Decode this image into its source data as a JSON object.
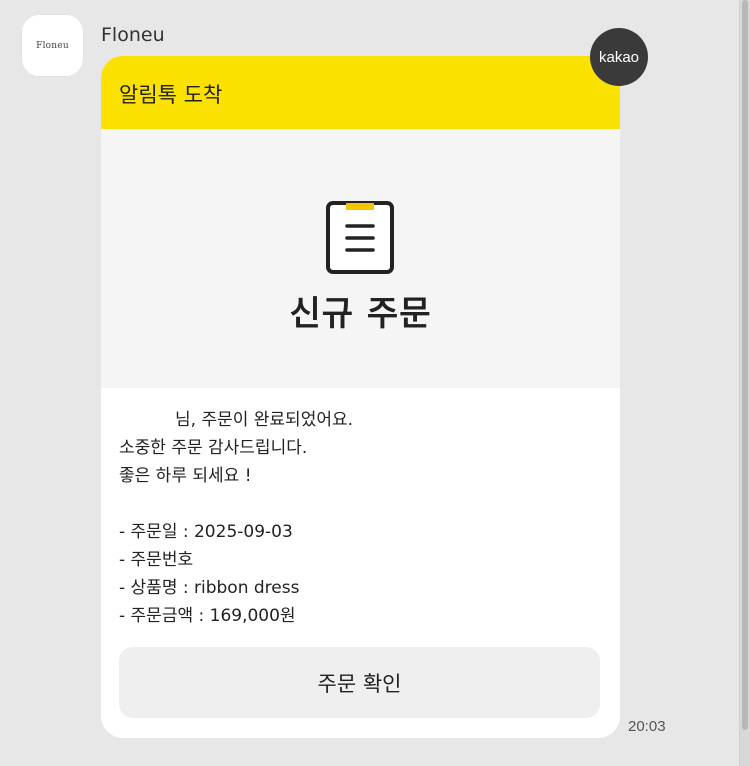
{
  "sender": {
    "name": "Floneu",
    "avatar_text": "Floneu"
  },
  "badge": {
    "label": "kakao"
  },
  "message": {
    "header_title": "알림톡 도착",
    "icon": "clipboard-icon",
    "hero_title": "신규 주문",
    "lines": [
      "님, 주문이 완료되었어요.",
      "소중한 주문 감사드립니다.",
      "좋은 하루 되세요 !",
      "- 주문일 : 2025-09-03",
      "- 주문번호",
      "- 상품명 : ribbon dress",
      "- 주문금액 : 169,000원"
    ],
    "button_label": "주문 확인",
    "timestamp": "20:03"
  },
  "colors": {
    "header_yellow": "#fae100",
    "background": "#e7e7e7",
    "badge_dark": "#3a3a3a"
  }
}
